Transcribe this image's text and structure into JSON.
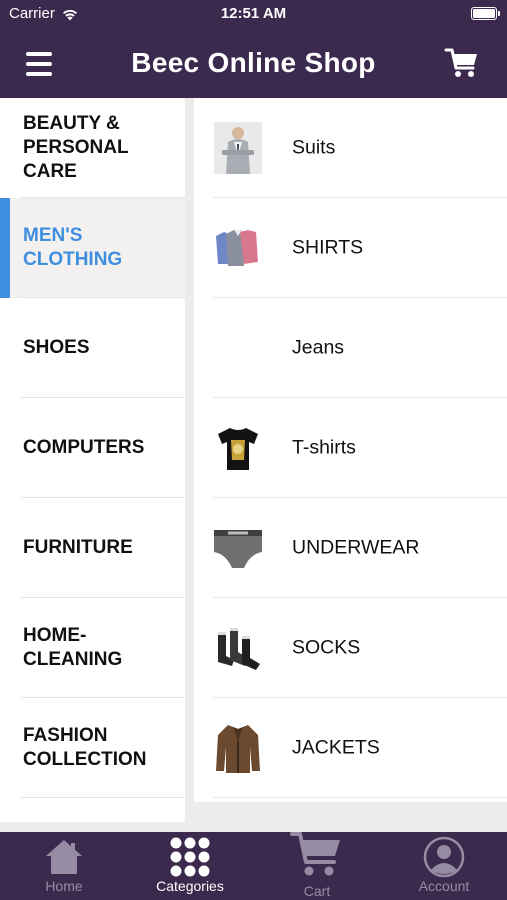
{
  "status_bar": {
    "carrier": "Carrier",
    "time": "12:51 AM"
  },
  "header": {
    "title": "Beec Online Shop"
  },
  "categories": [
    {
      "label": "BEAUTY &\nPERSONAL\nCARE",
      "active": false
    },
    {
      "label": "MEN'S\nCLOTHING",
      "active": true
    },
    {
      "label": "SHOES",
      "active": false
    },
    {
      "label": "COMPUTERS",
      "active": false
    },
    {
      "label": "FURNITURE",
      "active": false
    },
    {
      "label": "HOME-\nCLEANING",
      "active": false
    },
    {
      "label": "FASHION\nCOLLECTION",
      "active": false
    }
  ],
  "subcategories": [
    {
      "label": "Suits",
      "icon": "suit-thumbnail"
    },
    {
      "label": "SHIRTS",
      "icon": "shirts-thumbnail"
    },
    {
      "label": "Jeans",
      "icon": ""
    },
    {
      "label": "T-shirts",
      "icon": "tshirt-thumbnail"
    },
    {
      "label": "UNDERWEAR",
      "icon": "underwear-thumbnail"
    },
    {
      "label": "SOCKS",
      "icon": "socks-thumbnail"
    },
    {
      "label": "JACKETS",
      "icon": "jacket-thumbnail"
    }
  ],
  "tabbar": {
    "home": "Home",
    "categories": "Categories",
    "cart": "Cart",
    "account": "Account",
    "active": "categories"
  },
  "colors": {
    "header_bg": "#3c2a4e",
    "accent": "#3f8ee0",
    "tab_inactive": "#958ca3"
  }
}
